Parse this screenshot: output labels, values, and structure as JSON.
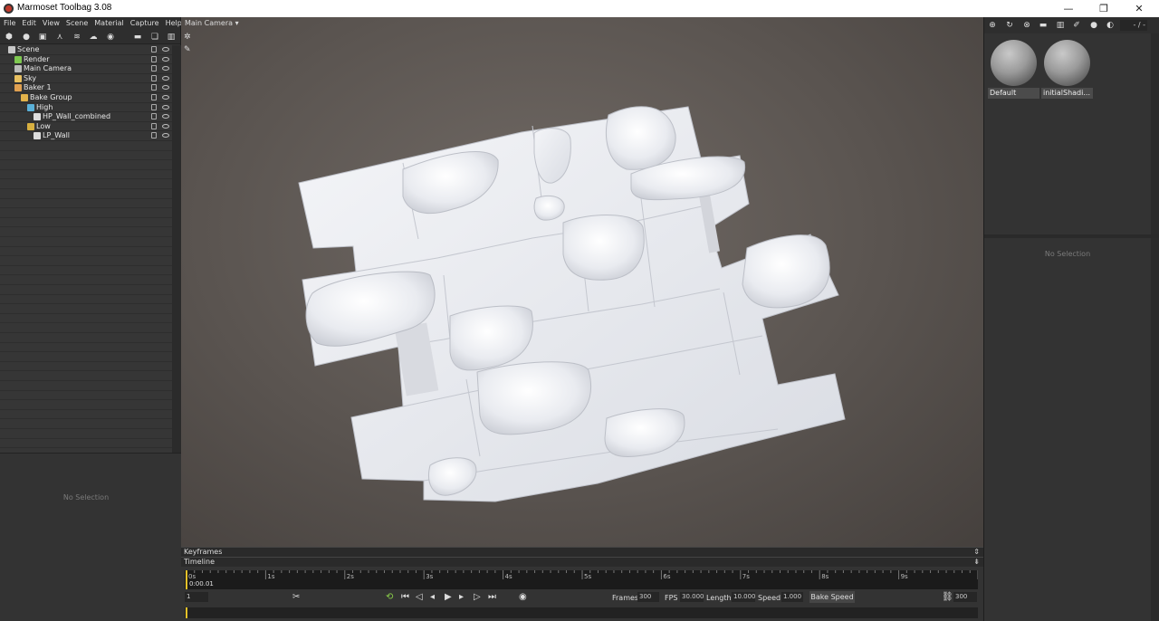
{
  "window": {
    "title": "Marmoset Toolbag 3.08",
    "controls": [
      "—",
      "❐",
      "✕"
    ]
  },
  "menu": [
    "File",
    "Edit",
    "View",
    "Scene",
    "Material",
    "Capture",
    "Help"
  ],
  "scene_tree": [
    {
      "label": "Scene",
      "depth": 0,
      "icon": "scene-icon",
      "color": "#c8c8c8"
    },
    {
      "label": "Render",
      "depth": 1,
      "icon": "render-icon",
      "color": "#7ec850"
    },
    {
      "label": "Main Camera",
      "depth": 1,
      "icon": "camera-icon",
      "color": "#bbbbbb"
    },
    {
      "label": "Sky",
      "depth": 1,
      "icon": "sky-icon",
      "color": "#e8c060"
    },
    {
      "label": "Baker 1",
      "depth": 1,
      "icon": "baker-icon",
      "color": "#e0a050"
    },
    {
      "label": "Bake Group",
      "depth": 2,
      "icon": "folder-icon",
      "color": "#e2b24a"
    },
    {
      "label": "High",
      "depth": 3,
      "icon": "high-icon",
      "color": "#5ab0d8"
    },
    {
      "label": "HP_Wall_combined",
      "depth": 4,
      "icon": "mesh-icon",
      "color": "#dddddd"
    },
    {
      "label": "Low",
      "depth": 3,
      "icon": "low-icon",
      "color": "#d8b040"
    },
    {
      "label": "LP_Wall",
      "depth": 4,
      "icon": "mesh-icon",
      "color": "#dddddd"
    }
  ],
  "left_panel": {
    "no_selection": "No Selection"
  },
  "viewport": {
    "camera_label": "Main Camera ▾"
  },
  "materials": [
    {
      "name": "Default"
    },
    {
      "name": "initialShadi..."
    }
  ],
  "right_panel": {
    "zoom": "- / -",
    "no_selection": "No Selection"
  },
  "timeline": {
    "keyframes_label": "Keyframes",
    "timeline_label": "Timeline",
    "current_time": "0:00.01",
    "ticks": [
      "0s",
      "1s",
      "2s",
      "3s",
      "4s",
      "5s",
      "6s",
      "7s",
      "8s",
      "9s"
    ],
    "current_frame": "1",
    "frames_label": "Frames",
    "frames_value": "300",
    "fps_label": "FPS",
    "fps_value": "30.000",
    "length_label": "Length",
    "length_value": "10.000",
    "speed_label": "Speed",
    "speed_value": "1.000",
    "bake_speed": "Bake Speed",
    "end_frame": "300"
  }
}
